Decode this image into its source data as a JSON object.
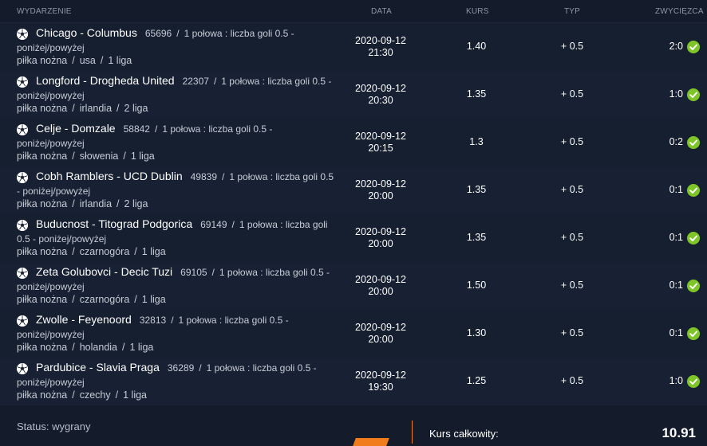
{
  "header": {
    "event": "WYDARZENIE",
    "date": "DATA",
    "odds": "KURS",
    "type": "TYP",
    "winner": "ZWYCIĘZCA"
  },
  "rows": [
    {
      "teams": "Chicago - Columbus",
      "code": "65696",
      "market": "1 połowa : liczba goli 0.5 - poniżej/powyżej",
      "sport": "piłka nożna",
      "country": "usa",
      "league": "1 liga",
      "date": "2020-09-12",
      "time": "21:30",
      "odds": "1.40",
      "type": "+ 0.5",
      "score": "2:0"
    },
    {
      "teams": "Longford - Drogheda United",
      "code": "22307",
      "market": "1 połowa : liczba goli 0.5 - poniżej/powyżej",
      "sport": "piłka nożna",
      "country": "irlandia",
      "league": "2 liga",
      "date": "2020-09-12",
      "time": "20:30",
      "odds": "1.35",
      "type": "+ 0.5",
      "score": "1:0"
    },
    {
      "teams": "Celje - Domzale",
      "code": "58842",
      "market": "1 połowa : liczba goli 0.5 - poniżej/powyżej",
      "sport": "piłka nożna",
      "country": "słowenia",
      "league": "1 liga",
      "date": "2020-09-12",
      "time": "20:15",
      "odds": "1.3",
      "type": "+ 0.5",
      "score": "0:2"
    },
    {
      "teams": "Cobh Ramblers - UCD Dublin",
      "code": "49839",
      "market": "1 połowa : liczba goli 0.5 - poniżej/powyżej",
      "sport": "piłka nożna",
      "country": "irlandia",
      "league": "2 liga",
      "date": "2020-09-12",
      "time": "20:00",
      "odds": "1.35",
      "type": "+ 0.5",
      "score": "0:1"
    },
    {
      "teams": "Buducnost - Titograd Podgorica",
      "code": "69149",
      "market": "1 połowa : liczba goli 0.5 - poniżej/powyżej",
      "sport": "piłka nożna",
      "country": "czarnogóra",
      "league": "1 liga",
      "date": "2020-09-12",
      "time": "20:00",
      "odds": "1.35",
      "type": "+ 0.5",
      "score": "0:1"
    },
    {
      "teams": "Zeta Golubovci - Decic Tuzi",
      "code": "69105",
      "market": "1 połowa : liczba goli 0.5 - poniżej/powyżej",
      "sport": "piłka nożna",
      "country": "czarnogóra",
      "league": "1 liga",
      "date": "2020-09-12",
      "time": "20:00",
      "odds": "1.50",
      "type": "+ 0.5",
      "score": "0:1"
    },
    {
      "teams": "Zwolle - Feyenoord",
      "code": "32813",
      "market": "1 połowa : liczba goli 0.5 - poniżej/powyżej",
      "sport": "piłka nożna",
      "country": "holandia",
      "league": "1 liga",
      "date": "2020-09-12",
      "time": "20:00",
      "odds": "1.30",
      "type": "+ 0.5",
      "score": "0:1"
    },
    {
      "teams": "Pardubice - Slavia Praga",
      "code": "36289",
      "market": "1 połowa : liczba goli 0.5 - poniżej/powyżej",
      "sport": "piłka nożna",
      "country": "czechy",
      "league": "1 liga",
      "date": "2020-09-12",
      "time": "19:30",
      "odds": "1.25",
      "type": "+ 0.5",
      "score": "1:0"
    }
  ],
  "footer": {
    "status": "Status: wygrany",
    "total_label": "Kurs całkowity:",
    "total_value": "10.91"
  },
  "colors": {
    "background": "#141c2c",
    "accent": "#f07c1b",
    "win": "#7ec627"
  },
  "icons": {
    "sport": "soccer-ball-icon",
    "result": "check-circle-icon"
  }
}
